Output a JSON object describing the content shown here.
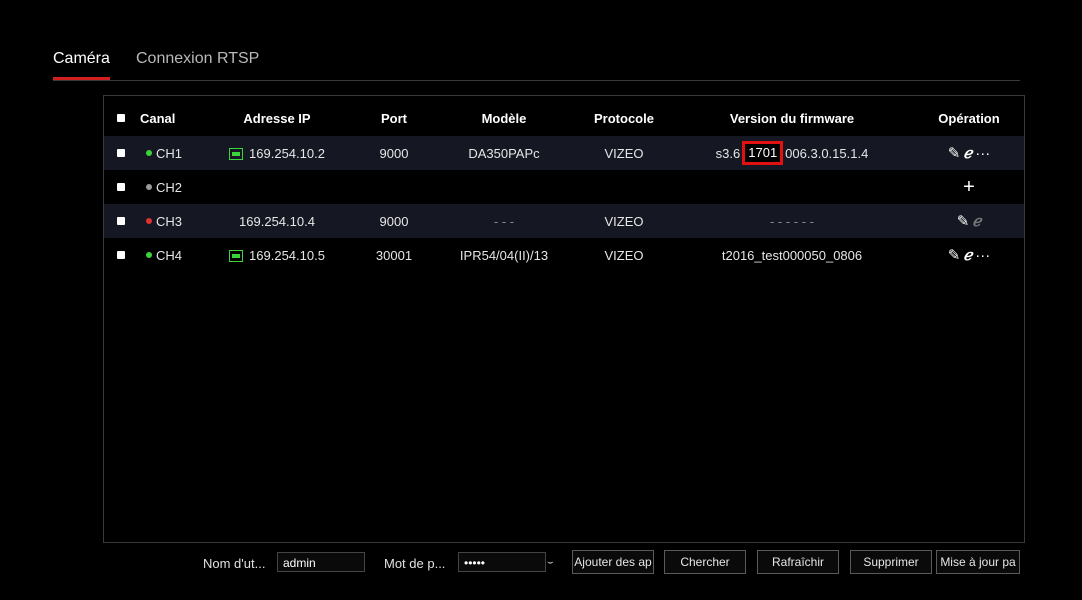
{
  "tabs": [
    {
      "label": "Caméra",
      "active": true
    },
    {
      "label": "Connexion RTSP",
      "active": false
    }
  ],
  "table": {
    "headers": {
      "canal": "Canal",
      "ip": "Adresse IP",
      "port": "Port",
      "model": "Modèle",
      "protocol": "Protocole",
      "firmware": "Version du firmware",
      "operation": "Opération"
    },
    "rows": [
      {
        "channel": "CH1",
        "status_color": "#3ad43a",
        "ip": "169.254.10.2",
        "ip_icon": "network-icon",
        "port": "9000",
        "model": "DA350PAPc",
        "protocol": "VIZEO",
        "firmware_prefix": "s3.6",
        "firmware_highlight": "1701",
        "firmware_suffix": "006.3.0.15.1.4",
        "ops": [
          "edit-icon",
          "ie-icon",
          "more-icon"
        ]
      },
      {
        "channel": "CH2",
        "status_color": "#9a9a9a",
        "ip": "",
        "port": "",
        "model": "",
        "protocol": "",
        "firmware": "",
        "ops": [
          "add-icon"
        ]
      },
      {
        "channel": "CH3",
        "status_color": "#e03030",
        "ip": "169.254.10.4",
        "port": "9000",
        "model": "- - -",
        "protocol": "VIZEO",
        "firmware": "- - - - - -",
        "ops": [
          "edit-icon",
          "ie-icon"
        ]
      },
      {
        "channel": "CH4",
        "status_color": "#3ad43a",
        "ip": "169.254.10.5",
        "ip_icon": "network-icon",
        "port": "30001",
        "model": "IPR54/04(II)/13",
        "protocol": "VIZEO",
        "firmware": "t2016_test000050_0806",
        "ops": [
          "edit-icon",
          "ie-icon",
          "more-icon"
        ]
      }
    ]
  },
  "footer": {
    "username_label": "Nom d'ut...",
    "username_value": "admin",
    "password_label": "Mot de p...",
    "password_value": "•••••",
    "add_button": "Ajouter des ap",
    "search_button": "Chercher",
    "refresh_button": "Rafraîchir",
    "delete_button": "Supprimer",
    "update_button": "Mise à jour pa"
  },
  "icons": {
    "edit": "✎",
    "ie": "ℯ",
    "more": "···",
    "add": "+",
    "eye": "👁"
  },
  "colors": {
    "accent": "#d21f1f",
    "online": "#3ad43a",
    "offline": "#e03030",
    "unset": "#9a9a9a"
  }
}
